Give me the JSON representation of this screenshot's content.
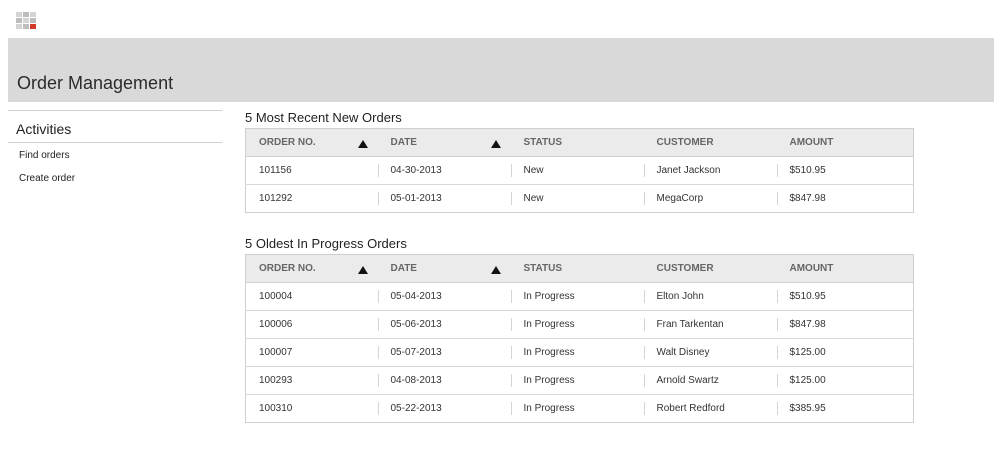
{
  "page": {
    "title": "Order Management"
  },
  "sidebar": {
    "heading": "Activities",
    "items": [
      {
        "label": "Find orders"
      },
      {
        "label": "Create order"
      }
    ]
  },
  "recent_orders": {
    "title": "5 Most Recent New Orders",
    "columns": [
      "ORDER NO.",
      "DATE",
      "STATUS",
      "CUSTOMER",
      "AMOUNT"
    ],
    "rows": [
      {
        "order_no": "101156",
        "date": "04-30-2013",
        "status": "New",
        "customer": "Janet Jackson",
        "amount": "$510.95"
      },
      {
        "order_no": "101292",
        "date": "05-01-2013",
        "status": "New",
        "customer": "MegaCorp",
        "amount": "$847.98"
      }
    ]
  },
  "in_progress_orders": {
    "title": "5 Oldest In Progress Orders",
    "columns": [
      "ORDER NO.",
      "DATE",
      "STATUS",
      "CUSTOMER",
      "AMOUNT"
    ],
    "rows": [
      {
        "order_no": "100004",
        "date": "05-04-2013",
        "status": "In Progress",
        "customer": "Elton John",
        "amount": "$510.95"
      },
      {
        "order_no": "100006",
        "date": "05-06-2013",
        "status": "In Progress",
        "customer": "Fran Tarkentan",
        "amount": "$847.98"
      },
      {
        "order_no": "100007",
        "date": "05-07-2013",
        "status": "In Progress",
        "customer": "Walt Disney",
        "amount": "$125.00"
      },
      {
        "order_no": "100293",
        "date": "04-08-2013",
        "status": "In Progress",
        "customer": "Arnold Swartz",
        "amount": "$125.00"
      },
      {
        "order_no": "100310",
        "date": "05-22-2013",
        "status": "In Progress",
        "customer": "Robert Redford",
        "amount": "$385.95"
      }
    ]
  },
  "icons": {
    "logo": "grid-logo-icon",
    "sort": "sort-ascending-icon"
  },
  "colors": {
    "banner": "#d9d9d9",
    "header_bg": "#ebebeb",
    "logo_accent": "#d2382a"
  }
}
